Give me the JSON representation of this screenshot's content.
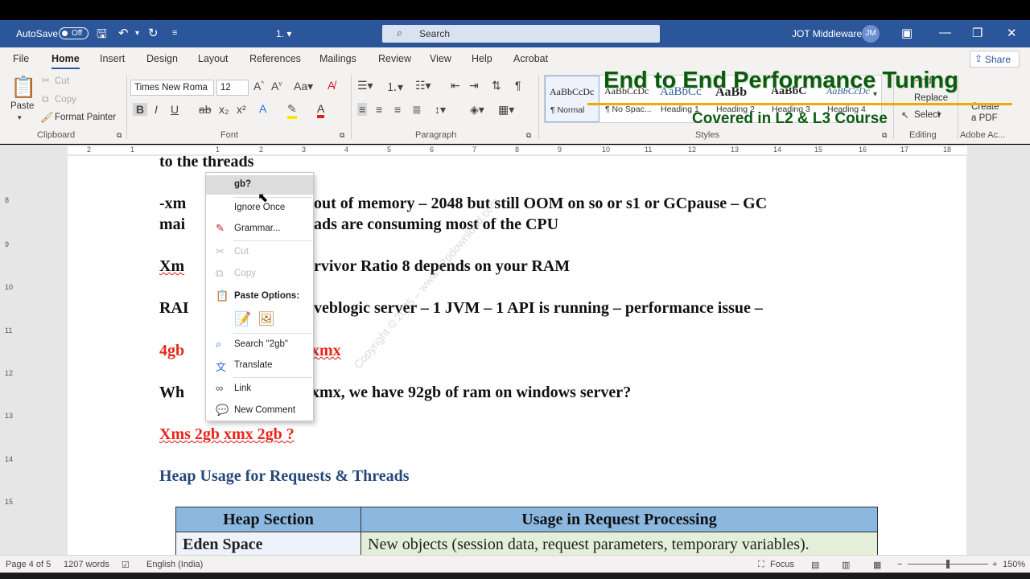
{
  "titlebar": {
    "autosave_label": "AutoSave",
    "autosave_state": "Off",
    "doc_title": "1. ▾",
    "search_placeholder": "Search",
    "user_name": "JOT Middleware",
    "user_initials": "JM",
    "icons": [
      "save-icon",
      "undo-icon",
      "redo-icon",
      "customize-icon",
      "ribbon-display-icon",
      "minimize-icon",
      "maximize-icon",
      "close-icon"
    ]
  },
  "menu": {
    "tabs": [
      "File",
      "Home",
      "Insert",
      "Design",
      "Layout",
      "References",
      "Mailings",
      "Review",
      "View",
      "Help",
      "Acrobat"
    ],
    "active": "Home",
    "share_label": "Share"
  },
  "ribbon": {
    "clipboard": {
      "paste": "Paste",
      "cut": "Cut",
      "copy": "Copy",
      "format_painter": "Format Painter",
      "label": "Clipboard"
    },
    "font": {
      "font_name": "Times New Roma",
      "font_size": "12",
      "label": "Font"
    },
    "paragraph": {
      "label": "Paragraph"
    },
    "styles": {
      "label": "Styles",
      "tiles": [
        {
          "preview": "AaBbCcDc",
          "name": "¶ Normal"
        },
        {
          "preview": "AaBbCcDc",
          "name": "¶ No Spac..."
        },
        {
          "preview": "AaBbCc",
          "name": "Heading 1"
        },
        {
          "preview": "AaBb",
          "name": "Heading 2"
        },
        {
          "preview": "AaBbC",
          "name": "Heading 3"
        },
        {
          "preview": "AaBbCcDc",
          "name": "Heading 4"
        }
      ]
    },
    "editing": {
      "find": "Find",
      "replace": "Replace",
      "select": "Select",
      "label": "Editing"
    },
    "adobe": {
      "create": "Create",
      "pdf": "a PDF",
      "label": "Adobe Ac..."
    }
  },
  "banner": {
    "title": "End to End Performance Tuning",
    "subtitle": "Covered in L2 & L3 Course"
  },
  "ruler": {
    "ticks": [
      "2",
      "1",
      "1",
      "2",
      "3",
      "4",
      "5",
      "6",
      "7",
      "8",
      "9",
      "10",
      "11",
      "12",
      "13",
      "14",
      "15",
      "16",
      "17",
      "18"
    ]
  },
  "vruler": {
    "ticks": [
      "8",
      "9",
      "10",
      "11",
      "12",
      "13",
      "14",
      "15"
    ]
  },
  "document": {
    "line0": "to the threads",
    "line1a": "-xm",
    "line1b": "out of memory – 2048 but still OOM on so or s1 or GCpause – GC",
    "line2a": "mai",
    "line2b": "ads are consuming most of the CPU",
    "line3a": "Xm",
    "line3b": "rvivor Ratio 8 depends on your RAM",
    "line4a": "RAI",
    "line4b": "veblogic server – 1 JVM – 1 API is running – performance issue –",
    "line5a": "4gb",
    "line5b": "xmx",
    "line6a": "Wh",
    "line6b": "xmx, we have 92gb of ram on windows server?",
    "line7": "Xms 2gb xmx 2gb ?",
    "heading": "Heap Usage for Requests & Threads",
    "watermark": "Copyright © 2025 – www.p2pdownload.com",
    "table": {
      "headers": [
        "Heap Section",
        "Usage in Request Processing"
      ],
      "rows": [
        [
          "Eden Space",
          "New objects (session data, request parameters, temporary variables)."
        ]
      ]
    }
  },
  "context_menu": {
    "suggestion": "gb?",
    "ignore": "Ignore Once",
    "grammar": "Grammar...",
    "cut": "Cut",
    "copy": "Copy",
    "paste_options": "Paste Options:",
    "search": "Search \"2gb\"",
    "translate": "Translate",
    "link": "Link",
    "new_comment": "New Comment"
  },
  "status": {
    "page": "Page 4 of 5",
    "words": "1207 words",
    "language": "English (India)",
    "focus": "Focus",
    "zoom": "150%"
  }
}
